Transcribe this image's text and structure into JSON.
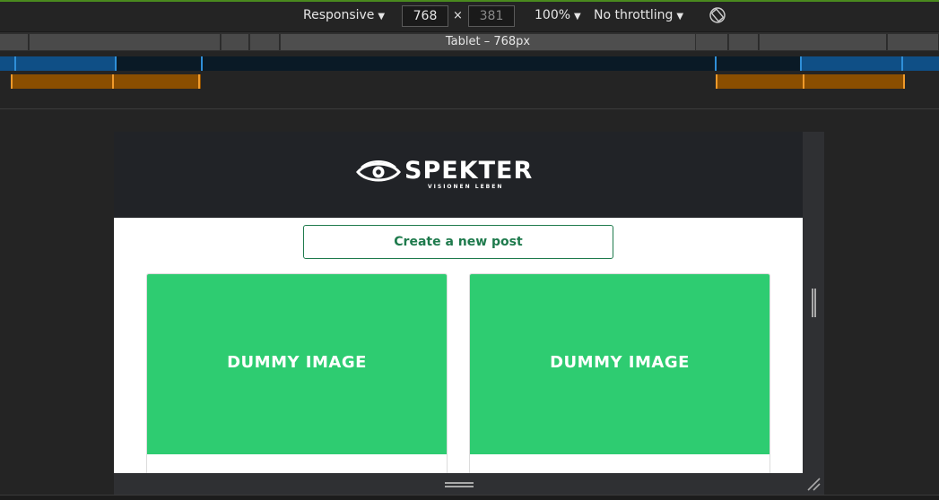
{
  "devtools": {
    "device_label": "Responsive",
    "width_value": "768",
    "height_value": "381",
    "times_sign": "×",
    "zoom_label": "100%",
    "throttle_label": "No throttling",
    "caret": "▼",
    "media_query_label": "Tablet – 768px"
  },
  "site": {
    "brand": "SPEKTER",
    "tagline": "VISIONEN LEBEN",
    "create_button": "Create a new post",
    "cards": [
      {
        "image_text": "DUMMY IMAGE"
      },
      {
        "image_text": "DUMMY IMAGE"
      }
    ]
  },
  "colors": {
    "header_bg": "#212327",
    "accent_green": "#2ecc71",
    "button_text": "#1e7a4c",
    "breakpoint_blue": "#2f8fd8",
    "breakpoint_orange": "#f09a2a"
  },
  "icons": [
    "rotate-icon",
    "eye-logo-icon",
    "resize-handle-icon",
    "corner-resize-icon"
  ]
}
